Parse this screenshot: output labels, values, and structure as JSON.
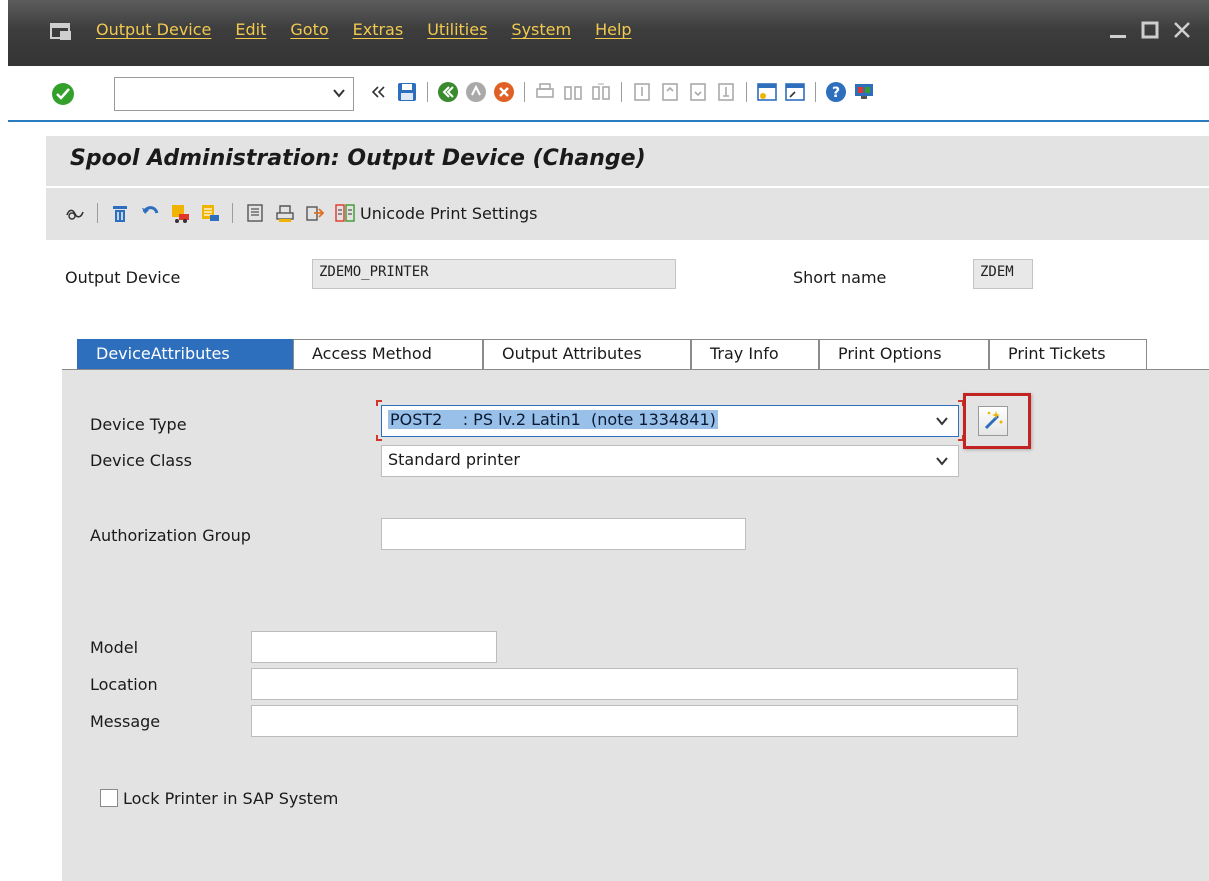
{
  "menubar": {
    "items": [
      "Output Device",
      "Edit",
      "Goto",
      "Extras",
      "Utilities",
      "System",
      "Help"
    ],
    "text_color": "#f1c94f"
  },
  "window_controls": [
    "minimize-icon",
    "maximize-icon",
    "close-icon"
  ],
  "standard_toolbar": {
    "command_field_value": "",
    "icons": [
      "enter-icon",
      "dropdown-icon",
      "history-icon",
      "save-icon",
      "back-icon",
      "exit-icon",
      "cancel-icon",
      "print-icon",
      "find-icon",
      "find-next-icon",
      "first-page-icon",
      "previous-page-icon",
      "next-page-icon",
      "last-page-icon",
      "new-session-icon",
      "shortcut-icon",
      "help-icon",
      "customize-layout-icon"
    ]
  },
  "title": "Spool Administration: Output Device (Change)",
  "app_toolbar": {
    "icons": [
      "display-change-icon",
      "delete-icon",
      "undo-icon",
      "transport-icon",
      "transport-list-icon",
      "other-device-icon",
      "print-test-icon",
      "export-icon"
    ],
    "unicode_label": "Unicode Print Settings"
  },
  "header": {
    "output_device_label": "Output Device",
    "output_device_value": "ZDEMO_PRINTER",
    "short_name_label": "Short name",
    "short_name_value": "ZDEM"
  },
  "tabs": [
    "DeviceAttributes",
    "Access Method",
    "Output Attributes",
    "Tray Info",
    "Print Options",
    "Print Tickets"
  ],
  "active_tab": "DeviceAttributes",
  "form": {
    "device_type_label": "Device Type",
    "device_type_value": "POST2    : PS lv.2 Latin1  (note 1334841)",
    "device_class_label": "Device Class",
    "device_class_value": "Standard printer",
    "authorization_group_label": "Authorization Group",
    "authorization_group_value": "",
    "model_label": "Model",
    "model_value": "",
    "location_label": "Location",
    "location_value": "",
    "message_label": "Message",
    "message_value": "",
    "lock_printer_label": "Lock Printer in SAP System",
    "lock_printer_checked": false
  },
  "colors": {
    "tab_active": "#2d6ebd",
    "highlight": "#c42323",
    "panel": "#e3e3e3"
  }
}
